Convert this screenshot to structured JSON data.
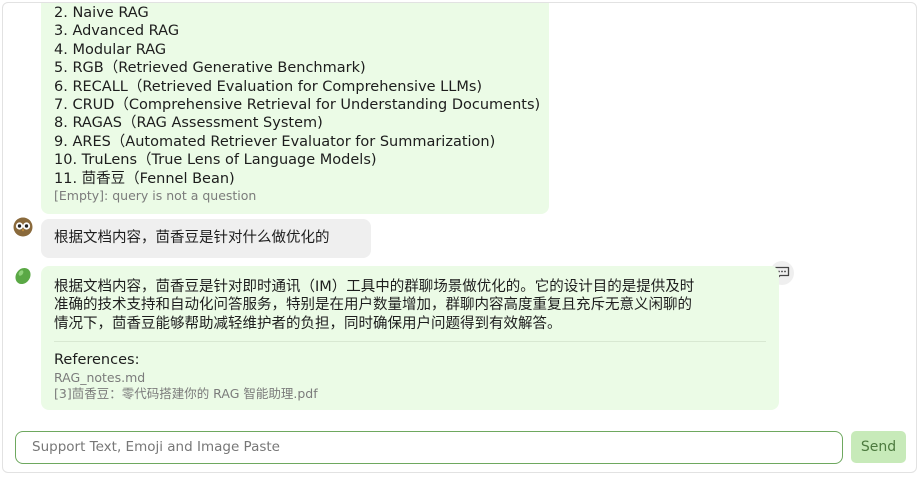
{
  "previous_message": {
    "lines": [
      "2. Naive RAG",
      "3. Advanced RAG",
      "4. Modular RAG",
      "5. RGB（Retrieved Generative Benchmark)",
      "6. RECALL（Retrieved Evaluation for Comprehensive LLMs)",
      "7. CRUD（Comprehensive Retrieval for Understanding Documents)",
      "8. RAGAS（RAG Assessment System)",
      "9. ARES（Automated Retriever Evaluator for Summarization)",
      "10. TruLens（True Lens of Language Models)",
      "11. 茴香豆（Fennel Bean)"
    ],
    "note": "[Empty]: query is not a question"
  },
  "user_message": {
    "avatar_icon": "owl-emoji-icon",
    "text": "根据文档内容，茴香豆是针对什么做优化的"
  },
  "bot_message": {
    "avatar_icon": "bean-icon",
    "lines": [
      "根据文档内容，茴香豆是针对即时通讯（IM）工具中的群聊场景做优化的。它的设计目的是提供及时",
      "准确的技术支持和自动化问答服务，特别是在用户数量增加，群聊内容高度重复且充斥无意义闲聊的",
      "情况下，茴香豆能够帮助减轻维护者的负担，同时确保用户问题得到有效解答。"
    ],
    "references_label": "References:",
    "references": [
      "RAG_notes.md",
      "[3]茴香豆：零代码搭建你的 RAG 智能助理.pdf"
    ]
  },
  "composer": {
    "placeholder": "Support Text, Emoji and Image Paste",
    "send_label": "Send"
  },
  "colors": {
    "bot_bubble": "#ebfbe6",
    "user_bubble": "#efefef",
    "accent": "#6ea85f",
    "send_bg": "#c7eab9"
  }
}
